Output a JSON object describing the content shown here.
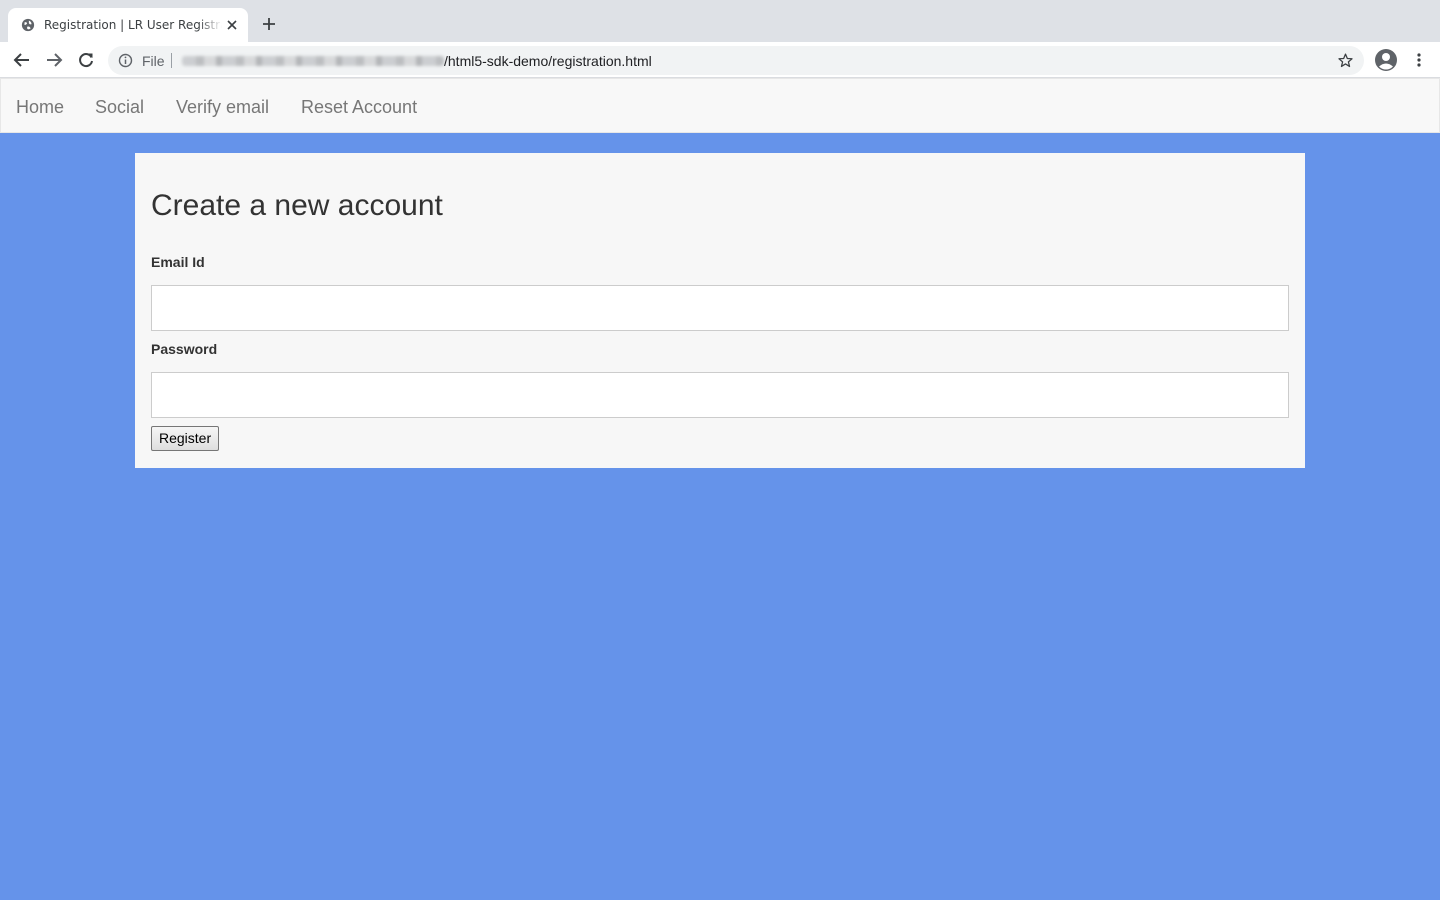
{
  "browser": {
    "tab_title": "Registration | LR User Registration",
    "url_scheme_label": "File",
    "url_visible_path": "/html5-sdk-demo/registration.html",
    "icons": [
      "globe-icon",
      "close-icon",
      "plus-icon",
      "back-arrow-icon",
      "forward-arrow-icon",
      "reload-icon",
      "info-icon",
      "star-icon",
      "profile-icon",
      "kebab-menu-icon"
    ]
  },
  "nav": {
    "items": [
      {
        "label": "Home"
      },
      {
        "label": "Social"
      },
      {
        "label": "Verify email"
      },
      {
        "label": "Reset Account"
      }
    ]
  },
  "form": {
    "title": "Create a new account",
    "email_label": "Email Id",
    "email_value": "",
    "password_label": "Password",
    "password_value": "",
    "submit_label": "Register"
  },
  "colors": {
    "page_background": "#6593ea",
    "card_background": "#f7f7f7",
    "navbar_background": "#f8f8f8"
  }
}
